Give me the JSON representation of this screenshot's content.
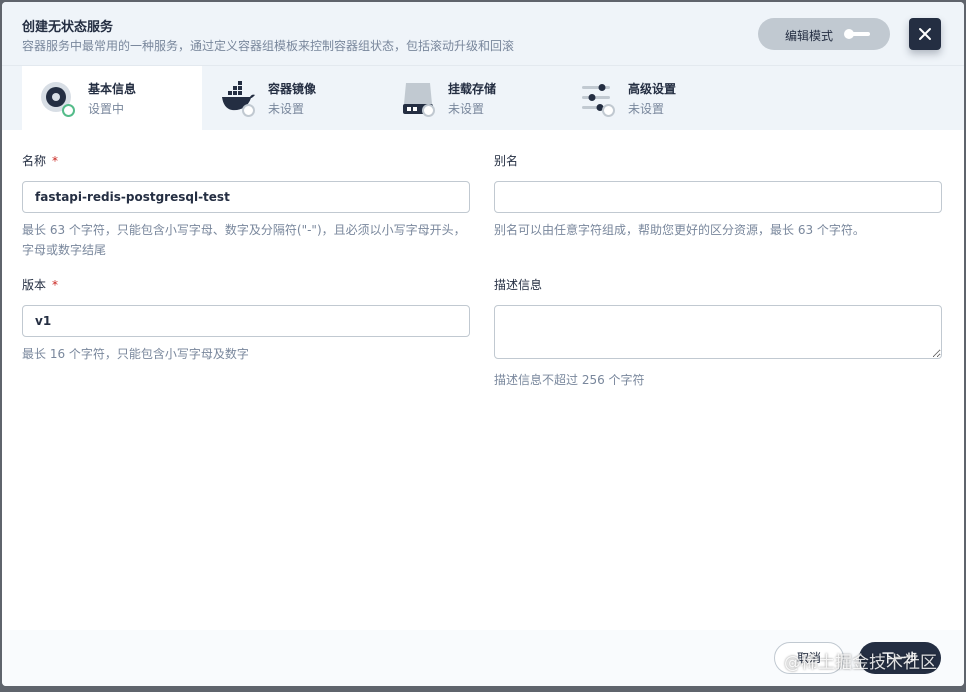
{
  "header": {
    "title": "创建无状态服务",
    "description": "容器服务中最常用的一种服务，通过定义容器组模板来控制容器组状态，包括滚动升级和回滚",
    "edit_mode_label": "编辑模式"
  },
  "tabs": [
    {
      "name": "基本信息",
      "state": "设置中",
      "icon": "basic-info-icon"
    },
    {
      "name": "容器镜像",
      "state": "未设置",
      "icon": "docker-icon"
    },
    {
      "name": "挂载存储",
      "state": "未设置",
      "icon": "storage-icon"
    },
    {
      "name": "高级设置",
      "state": "未设置",
      "icon": "sliders-icon"
    }
  ],
  "form": {
    "name": {
      "label": "名称",
      "required_mark": "*",
      "value": "fastapi-redis-postgresql-test",
      "hint": "最长 63 个字符，只能包含小写字母、数字及分隔符(\"-\")，且必须以小写字母开头，字母或数字结尾"
    },
    "alias": {
      "label": "别名",
      "value": "",
      "hint": "别名可以由任意字符组成，帮助您更好的区分资源，最长 63 个字符。"
    },
    "version": {
      "label": "版本",
      "required_mark": "*",
      "value": "v1",
      "hint": "最长 16 个字符，只能包含小写字母及数字"
    },
    "description": {
      "label": "描述信息",
      "value": "",
      "hint": "描述信息不超过 256 个字符"
    }
  },
  "footer": {
    "cancel_label": "取消",
    "next_label": "下一步"
  },
  "watermark": "@稀土掘金技术社区",
  "colors": {
    "dark": "#242e42",
    "muted": "#79879c",
    "active_dot": "#55bc8a",
    "required": "#ca2621"
  }
}
